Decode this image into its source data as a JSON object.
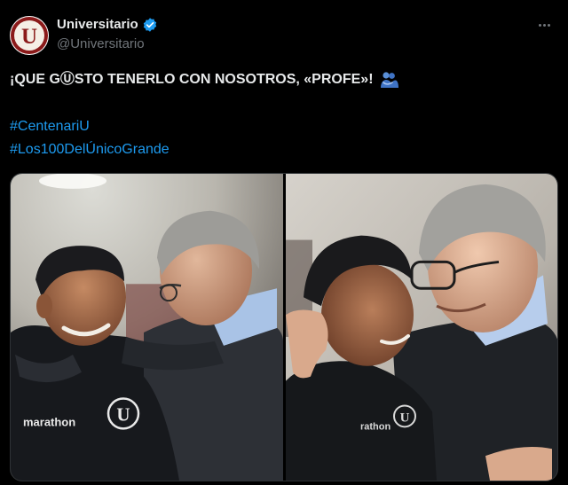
{
  "account": {
    "display_name": "Universitario",
    "handle": "@Universitario",
    "verified": true,
    "avatar_letter": "U"
  },
  "tweet": {
    "headline": "¡QUE GⓊSTO TENERLO CON NOSOTROS, «PROFE»!",
    "hashtags": [
      "#CentenariU",
      "#Los100DelÚnicoGrande"
    ]
  },
  "media": {
    "photos": [
      {
        "jacket_text": "marathon",
        "crest_letter": "U"
      },
      {
        "jacket_text": "rathon",
        "crest_letter": "U"
      }
    ]
  },
  "colors": {
    "background": "#000000",
    "text": "#e7e9ea",
    "secondary": "#71767b",
    "link": "#1d9bf0",
    "verified": "#1d9bf0",
    "brand_red": "#8b1a1a"
  },
  "icons": {
    "verified": "verified-badge-icon",
    "more": "more-dots-icon",
    "emoji": "people-hugging-emoji"
  }
}
